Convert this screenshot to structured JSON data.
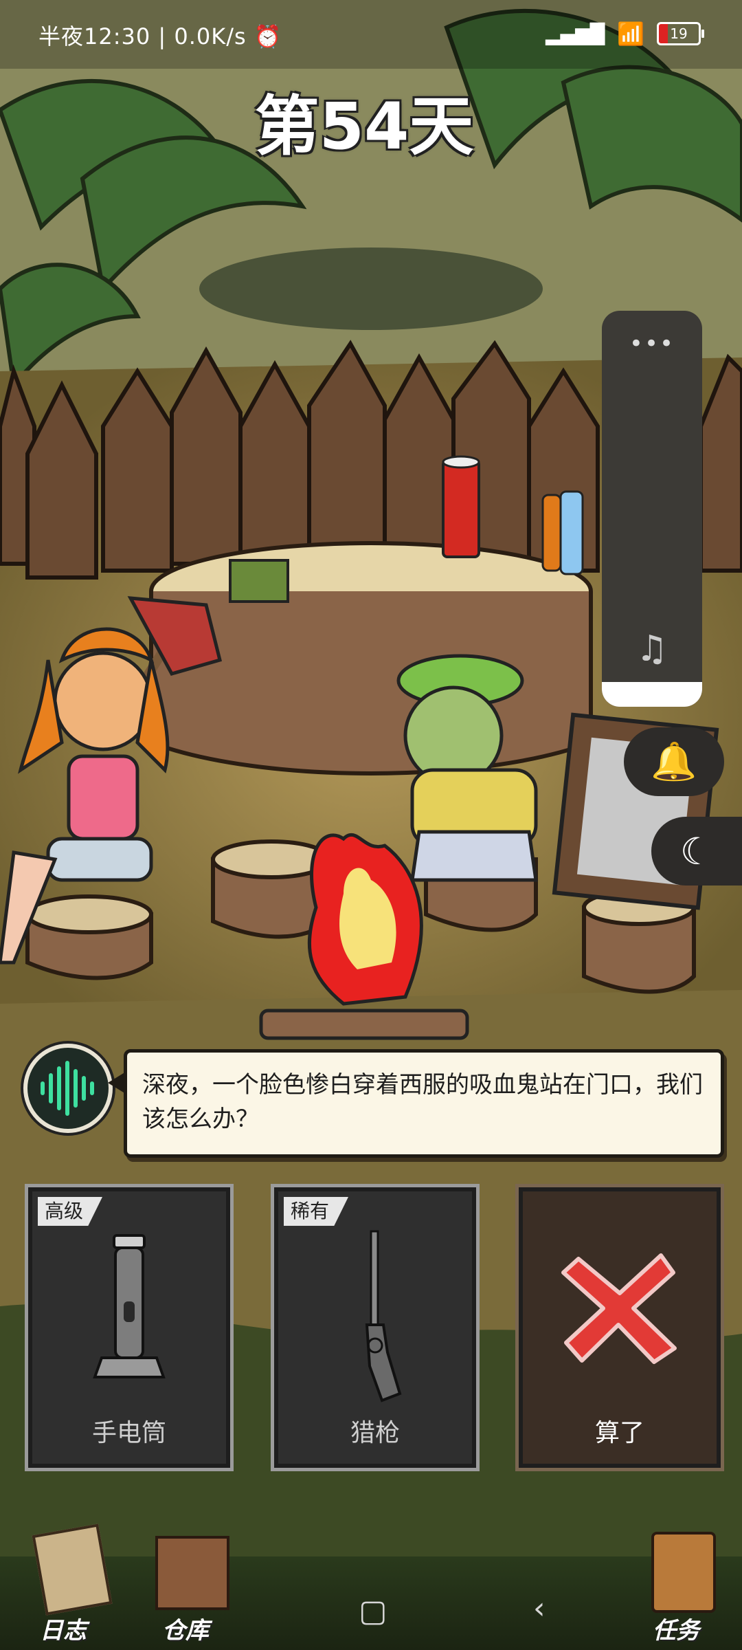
{
  "status_bar": {
    "time": "半夜12:30",
    "network_speed": "0.0K/s",
    "alarm_icon": "alarm-icon",
    "signal_icon": "signal-hd-icon",
    "wifi_icon": "wifi-icon",
    "battery_level": "19"
  },
  "day_title": "第54天",
  "floating_panel": {
    "menu_icon": "more-dots-icon",
    "music_icon": "music-note-icon",
    "bell_icon": "bell-icon",
    "moon_icon": "moon-icon"
  },
  "dialog": {
    "text": "深夜，一个脸色惨白穿着西服的吸血鬼站在门口，我们该怎么办？",
    "avatar_icon": "sound-wave-icon"
  },
  "choices": [
    {
      "tag": "高级",
      "label": "手电筒",
      "icon": "flashlight-icon"
    },
    {
      "tag": "稀有",
      "label": "猎枪",
      "icon": "hunting-rifle-icon"
    },
    {
      "label": "算了",
      "icon": "red-x-icon"
    }
  ],
  "bottom_nav": {
    "journal": "日志",
    "warehouse": "仓库",
    "tasks": "任务"
  },
  "colors": {
    "dialog_bg": "#fbf6e6",
    "cancel_x": "#e23a36",
    "panel_bg": "#3c3a36"
  }
}
